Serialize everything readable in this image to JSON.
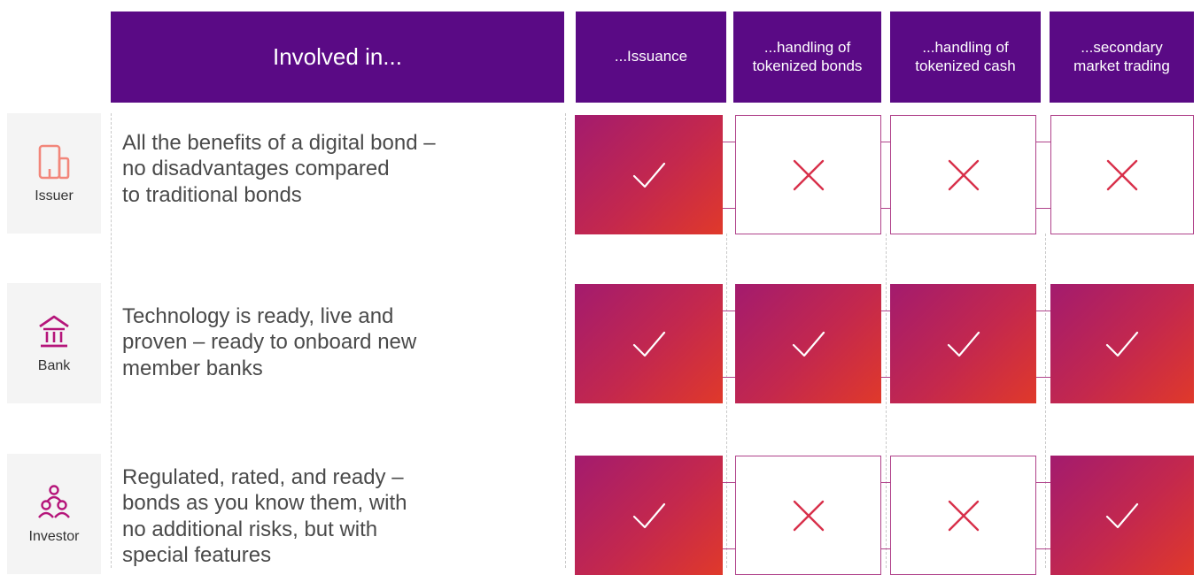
{
  "header": {
    "involved_label": "Involved in...",
    "columns": [
      {
        "line1": "...Issuance",
        "line2": ""
      },
      {
        "line1": "...handling of",
        "line2": "tokenized bonds"
      },
      {
        "line1": "...handling of",
        "line2": "tokenized cash"
      },
      {
        "line1": "...secondary",
        "line2": "market trading"
      }
    ]
  },
  "rows": [
    {
      "label": "Issuer",
      "icon": "building-icon",
      "description": [
        "All the benefits of a digital bond –",
        "no disadvantages compared",
        "to traditional bonds"
      ],
      "cells": [
        true,
        false,
        false,
        false
      ]
    },
    {
      "label": "Bank",
      "icon": "bank-icon",
      "description": [
        "Technology is ready, live and",
        "proven – ready to onboard new",
        "member banks"
      ],
      "cells": [
        true,
        true,
        true,
        true
      ]
    },
    {
      "label": "Investor",
      "icon": "people-group-icon",
      "description": [
        "Regulated, rated, and ready –",
        "bonds as you know them, with",
        "no additional risks, but with",
        "special features"
      ],
      "cells": [
        true,
        false,
        false,
        true
      ]
    }
  ],
  "colors": {
    "header": "#5a0a85",
    "accent": "#c4284d",
    "issuer_icon": "#f2867a",
    "bank_icon": "#b5157a",
    "investor_icon": "#b5157a"
  }
}
